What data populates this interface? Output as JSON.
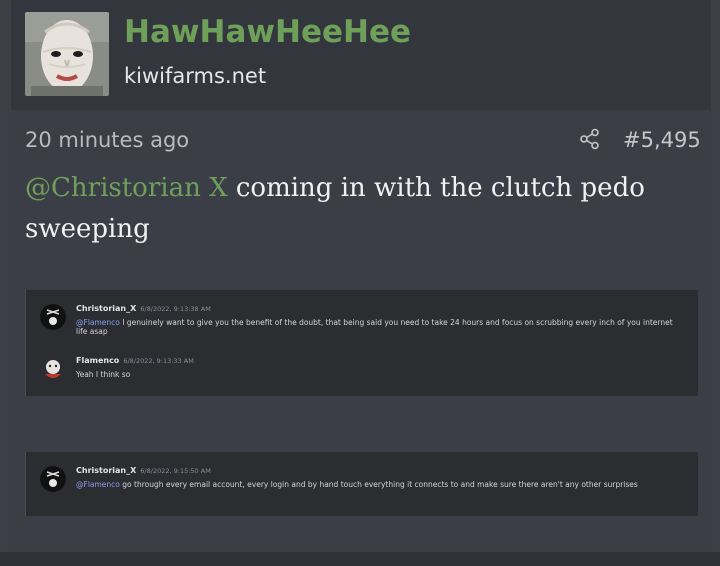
{
  "author": {
    "username": "HawHawHeeHee",
    "site": "kiwifarms.net"
  },
  "meta": {
    "time": "20 minutes ago",
    "post_number": "#5,495"
  },
  "post": {
    "mention": "@Christorian X",
    "text": " coming in with the clutch pedo sweeping"
  },
  "screenshot1": {
    "msg1": {
      "author": "Christorian_X",
      "time": "6/8/2022, 9:13:38 AM",
      "ping": "@Flamenco",
      "text": " I genuinely want to give you the benefit of the doubt, that being said you need to take 24 hours and focus on scrubbing every inch of you internet life asap"
    },
    "msg2": {
      "author": "Flamenco",
      "time": "6/8/2022, 9:13:33 AM",
      "text": "Yeah I think so"
    }
  },
  "screenshot2": {
    "msg1": {
      "author": "Christorian_X",
      "time": "6/8/2022, 9:15:50 AM",
      "ping": "@Flamenco",
      "text": " go through every email account, every login and by hand touch everything it connects to and make sure there aren't any other surprises"
    }
  },
  "icons": {
    "share": "share-icon"
  },
  "colors": {
    "accent_green": "#6ea05a",
    "ping_blue": "#8b9cf0"
  }
}
